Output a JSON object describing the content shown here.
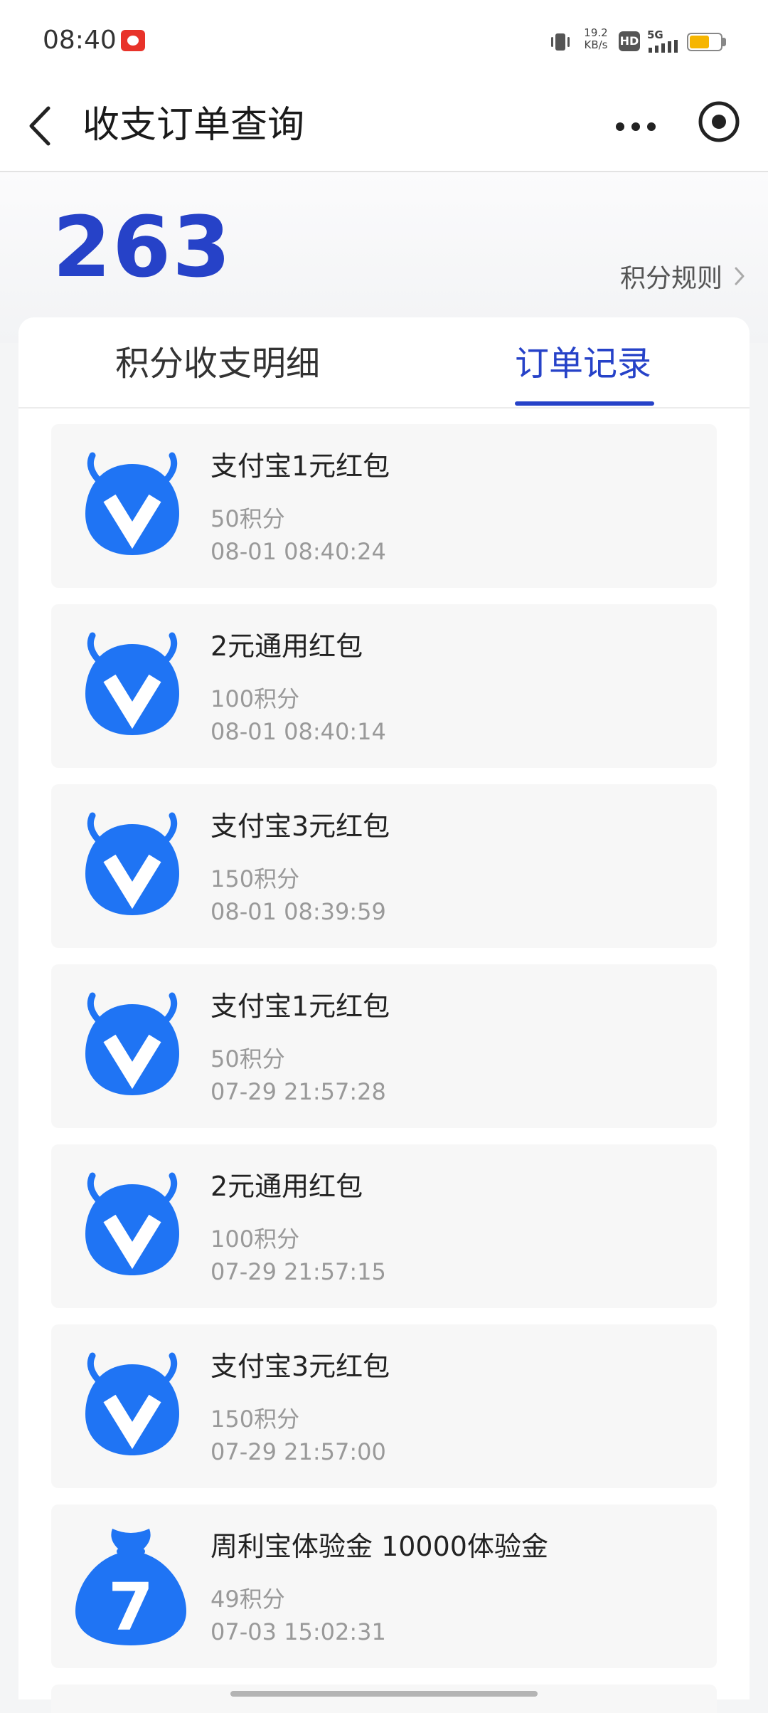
{
  "status_bar": {
    "time": "08:40",
    "net_speed_value": "19.2",
    "net_speed_unit": "KB/s",
    "hd_label": "HD",
    "network_label": "5G",
    "battery_level": 0.65,
    "battery_color": "#f6b500"
  },
  "nav": {
    "title": "收支订单查询",
    "back_icon": "chevron-left-icon",
    "more_icon": "more-horizontal-icon",
    "close_icon": "target-circle-icon"
  },
  "points": {
    "value": "263",
    "rules_label": "积分规则",
    "accent_color": "#2642c8"
  },
  "tabs": [
    {
      "label": "积分收支明细",
      "active": false
    },
    {
      "label": "订单记录",
      "active": true
    }
  ],
  "orders": [
    {
      "title": "支付宝1元红包",
      "points": "50积分",
      "time": "08-01 08:40:24",
      "icon": "v-pouch-icon"
    },
    {
      "title": "2元通用红包",
      "points": "100积分",
      "time": "08-01 08:40:14",
      "icon": "v-pouch-icon"
    },
    {
      "title": "支付宝3元红包",
      "points": "150积分",
      "time": "08-01 08:39:59",
      "icon": "v-pouch-icon"
    },
    {
      "title": "支付宝1元红包",
      "points": "50积分",
      "time": "07-29 21:57:28",
      "icon": "v-pouch-icon"
    },
    {
      "title": "2元通用红包",
      "points": "100积分",
      "time": "07-29 21:57:15",
      "icon": "v-pouch-icon"
    },
    {
      "title": "支付宝3元红包",
      "points": "150积分",
      "time": "07-29 21:57:00",
      "icon": "v-pouch-icon"
    },
    {
      "title": "周利宝体验金 10000体验金",
      "points": "49积分",
      "time": "07-03 15:02:31",
      "icon": "seven-money-bag-icon"
    }
  ],
  "colors": {
    "icon_blue": "#1f74f4",
    "card_background": "#f7f7f7"
  }
}
